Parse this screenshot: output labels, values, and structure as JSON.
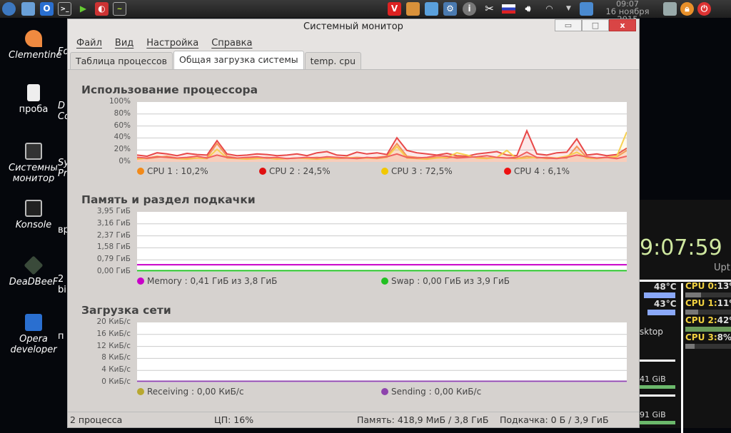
{
  "taskbar": {
    "time": "09:07",
    "date": "16 ноября 2015"
  },
  "desktop_icons": [
    "Clementine",
    "проба",
    "Системный монитор",
    "Konsole",
    "DeaDBeeF",
    "Opera developer"
  ],
  "desktop_icons_partial": [
    "Fo",
    "D Co",
    "Sy Pr",
    "вр",
    "2 bi",
    "п"
  ],
  "window": {
    "title": "Системный монитор",
    "buttons": {
      "minimize": "▭",
      "maximize": "□",
      "close": "x"
    }
  },
  "menu": [
    "Файл",
    "Вид",
    "Настройка",
    "Справка"
  ],
  "tabs": [
    "Таблица процессов",
    "Общая загрузка системы",
    "temp. cpu"
  ],
  "cpu": {
    "title": "Использование процессора",
    "legend": [
      {
        "label": "CPU 1 : 10,2%",
        "color": "#f28a1a"
      },
      {
        "label": "CPU 2 : 24,5%",
        "color": "#e01010"
      },
      {
        "label": "CPU 3 : 72,5%",
        "color": "#f2c800"
      },
      {
        "label": "CPU 4 : 6,1%",
        "color": "#ee1111"
      }
    ]
  },
  "memory": {
    "title": "Память и раздел подкачки",
    "legend": [
      {
        "label": "Memory : 0,41 ГиБ из 3,8 ГиБ",
        "color": "#c800c8"
      },
      {
        "label": "Swap : 0,00 ГиБ из 3,9 ГиБ",
        "color": "#22c022"
      }
    ]
  },
  "network": {
    "title": "Загрузка сети",
    "legend": [
      {
        "label": "Receiving : 0,00 КиБ/с",
        "color": "#b8a830"
      },
      {
        "label": "Sending : 0,00 КиБ/с",
        "color": "#8e44ad"
      }
    ]
  },
  "status": {
    "processes": "2 процесса",
    "cpu": "ЦП: 16%",
    "memory": "Память: 418,9 МиБ / 3,8 ГиБ",
    "swap": "Подкачка: 0 Б / 3,9 ГиБ"
  },
  "conky": {
    "clock": "9:07:59",
    "uptime": "Upti",
    "temps": [
      "48°C",
      "43°C"
    ],
    "desktop": "sktop",
    "disk": [
      "41 GiB",
      "91 GiB"
    ],
    "cpus": [
      {
        "label": "CPU 0:",
        "value": "13%",
        "pct": 13
      },
      {
        "label": "CPU 1:",
        "value": "11%",
        "pct": 11
      },
      {
        "label": "CPU 2:",
        "value": "42%",
        "pct": 42
      },
      {
        "label": "CPU 3:",
        "value": "8%",
        "pct": 8
      }
    ]
  },
  "chart_data": [
    {
      "type": "line",
      "title": "Использование процессора",
      "ylim": [
        0,
        100
      ],
      "yticks": [
        "100%",
        "80%",
        "60%",
        "40%",
        "20%",
        "0%"
      ],
      "series": [
        {
          "name": "CPU 1",
          "color": "#f5a05a",
          "values": [
            5,
            4,
            6,
            8,
            5,
            4,
            5,
            6,
            30,
            8,
            5,
            4,
            5,
            6,
            5,
            4,
            5,
            5,
            6,
            5,
            4,
            5,
            6,
            5,
            6,
            8,
            30,
            8,
            6,
            5,
            6,
            5,
            7,
            8,
            6,
            5,
            6,
            5,
            4,
            8,
            5,
            6,
            5,
            5,
            25,
            6,
            5,
            6,
            7,
            18
          ]
        },
        {
          "name": "CPU 2",
          "color": "#e84848",
          "values": [
            10,
            8,
            14,
            12,
            9,
            13,
            11,
            10,
            35,
            12,
            9,
            10,
            12,
            11,
            9,
            10,
            12,
            9,
            14,
            16,
            10,
            9,
            15,
            12,
            14,
            11,
            40,
            18,
            14,
            12,
            10,
            13,
            9,
            8,
            12,
            14,
            16,
            10,
            9,
            52,
            12,
            10,
            14,
            15,
            38,
            10,
            12,
            9,
            11,
            22
          ]
        },
        {
          "name": "CPU 3",
          "color": "#f7d050",
          "values": [
            3,
            5,
            8,
            6,
            4,
            3,
            5,
            4,
            20,
            5,
            4,
            3,
            4,
            5,
            3,
            4,
            5,
            4,
            3,
            4,
            5,
            6,
            4,
            5,
            4,
            6,
            25,
            5,
            4,
            3,
            5,
            6,
            14,
            10,
            5,
            4,
            6,
            18,
            4,
            5,
            6,
            4,
            5,
            8,
            15,
            5,
            4,
            6,
            8,
            50
          ]
        },
        {
          "name": "CPU 4",
          "color": "#f06060",
          "values": [
            6,
            5,
            7,
            6,
            5,
            6,
            8,
            5,
            10,
            6,
            5,
            6,
            7,
            5,
            6,
            4,
            5,
            6,
            5,
            7,
            6,
            5,
            4,
            6,
            5,
            7,
            12,
            6,
            5,
            6,
            9,
            8,
            5,
            6,
            7,
            9,
            6,
            5,
            6,
            15,
            6,
            5,
            4,
            6,
            10,
            7,
            5,
            6,
            4,
            8
          ]
        }
      ]
    },
    {
      "type": "line",
      "title": "Память и раздел подкачки",
      "ylim": [
        0,
        3.95
      ],
      "yticks": [
        "3,95 ГиБ",
        "3,16 ГиБ",
        "2,37 ГиБ",
        "1,58 ГиБ",
        "0,79 ГиБ",
        "0,00 ГиБ"
      ],
      "series": [
        {
          "name": "Memory",
          "color": "#c800c8",
          "values": [
            0.41,
            0.41
          ]
        },
        {
          "name": "Swap",
          "color": "#22c022",
          "values": [
            0,
            0
          ]
        }
      ]
    },
    {
      "type": "line",
      "title": "Загрузка сети",
      "ylim": [
        0,
        20
      ],
      "yticks": [
        "20 КиБ/с",
        "16 КиБ/с",
        "12 КиБ/с",
        "8 КиБ/с",
        "4 КиБ/с",
        "0 КиБ/с"
      ],
      "series": [
        {
          "name": "Receiving",
          "color": "#f0e060",
          "values": [
            0,
            0
          ]
        },
        {
          "name": "Sending",
          "color": "#8e44ad",
          "values": [
            0,
            0
          ]
        }
      ]
    }
  ]
}
